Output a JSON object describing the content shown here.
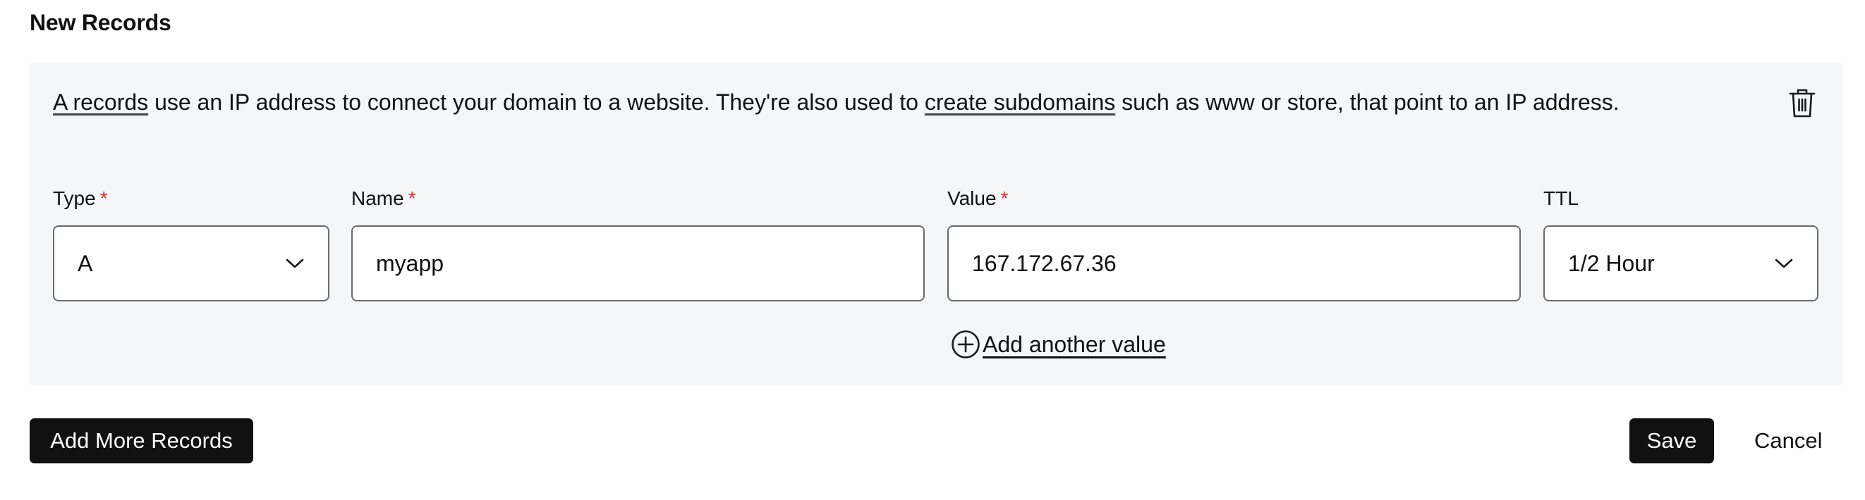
{
  "section": {
    "title": "New Records"
  },
  "record": {
    "info": {
      "link1": "A records",
      "text1": " use an IP address to connect your domain to a website. They're also used to ",
      "link2": "create subdomains",
      "text2": " such as www or store, that point to an IP address."
    },
    "delete_icon": "trash-icon",
    "fields": {
      "type": {
        "label": "Type",
        "required_mark": "*",
        "value": "A"
      },
      "name": {
        "label": "Name",
        "required_mark": "*",
        "value": "myapp"
      },
      "value": {
        "label": "Value",
        "required_mark": "*",
        "value": "167.172.67.36"
      },
      "ttl": {
        "label": "TTL",
        "value": "1/2 Hour"
      }
    },
    "add_value_label": "Add another value"
  },
  "actions": {
    "add_more_label": "Add More Records",
    "save_label": "Save",
    "cancel_label": "Cancel"
  },
  "colors": {
    "panel_bg": "#f5f6f7",
    "required": "#d1342f",
    "button_dark": "#111111"
  }
}
